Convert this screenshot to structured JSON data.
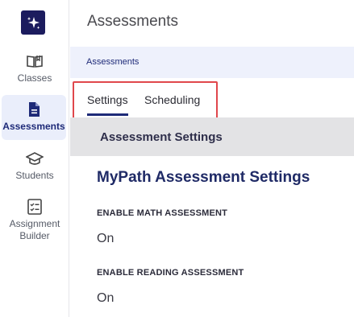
{
  "sidebar": {
    "logo_icon": "sparkle-icon",
    "items": [
      {
        "label": "Classes",
        "icon": "book-icon"
      },
      {
        "label": "Assessments",
        "icon": "document-icon"
      },
      {
        "label": "Students",
        "icon": "graduation-cap-icon"
      },
      {
        "label": "Assignment Builder",
        "icon": "checklist-icon"
      }
    ],
    "active_color": "#1e2a78",
    "active_bg": "#eaeefb"
  },
  "header": {
    "title": "Assessments"
  },
  "breadcrumb": {
    "label": "Assessments"
  },
  "tabs": [
    {
      "label": "Settings",
      "active": true
    },
    {
      "label": "Scheduling",
      "active": false
    }
  ],
  "section": {
    "title": "Assessment Settings"
  },
  "settings": {
    "heading": "MyPath Assessment Settings",
    "items": [
      {
        "label": "ENABLE MATH ASSESSMENT",
        "value": "On"
      },
      {
        "label": "ENABLE READING ASSESSMENT",
        "value": "On"
      }
    ]
  },
  "colors": {
    "highlight_border": "#e0474c",
    "breadcrumb_bg": "#eef1fc",
    "section_bg": "#e3e3e5"
  }
}
